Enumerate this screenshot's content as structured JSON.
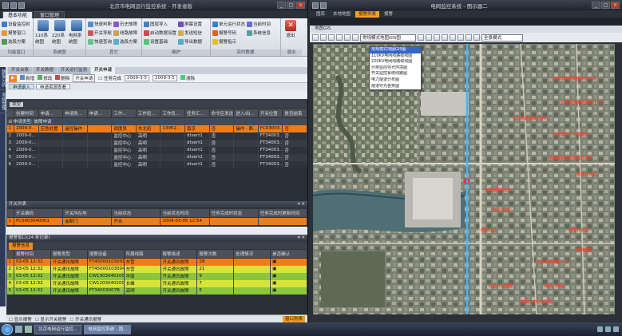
{
  "left_window": {
    "title": "北京市电网运行监控系统 - 开发者版",
    "ribbon_tabs": [
      "基本功能",
      "窗口管理"
    ],
    "ribbon_groups": [
      {
        "name": "功能窗口",
        "items": [
          "设备监控树",
          "报警窗口",
          "选段方案"
        ]
      },
      {
        "name": "系统图",
        "big": [
          "110系统图",
          "220系统图",
          "电网系统图"
        ]
      },
      {
        "name": "其它",
        "items": [
          "快速判断",
          "开关导航",
          "快速查询",
          "历史故障",
          "线路故障",
          "选段方案"
        ]
      },
      {
        "name": "维护",
        "items": [
          "图层导入",
          "启动数据设置",
          "设置基础",
          "屏幕设置",
          "发送短信",
          "导出数据"
        ]
      },
      {
        "name": "实时数据",
        "items": [
          "单元运行状态",
          "报警号码",
          "报警指示",
          "当前时间",
          "系统信息"
        ]
      },
      {
        "name": "退出",
        "big": [
          "退出"
        ]
      }
    ],
    "sidebar": [
      "数据分析",
      "系统管理"
    ],
    "doc_tabs": [
      "开关台账",
      "开关数据",
      "开关运行监测",
      "开关申请"
    ],
    "toolbar": {
      "checkbox": "任务完成",
      "date_from": "2009-3-5",
      "date_to": "2009-3-5",
      "clear_label": "清除",
      "add_label": "新增",
      "modify_label": "修改",
      "delete_label": "删除",
      "mode_label": "开关申请"
    },
    "sub_tabs": [
      "申请录入",
      "申请资源查看"
    ],
    "grid": {
      "group_label": "类型",
      "columns": [
        "创建时间",
        "申请...",
        "申请类...",
        "申请...",
        "工作...",
        "工作班...",
        "工作负...",
        "任务汇...",
        "命令区发送",
        "进入/出...",
        "开关位置",
        "是否结束"
      ],
      "subgroup": "申请类型: 故障申请",
      "rows": [
        {
          "style": "r-orange",
          "cells": [
            "2009-0...",
            "应急处置",
            "遥控操作",
            "",
            "调度员",
            "东北班",
            "13952...",
            "南京",
            "否",
            "操作 - 断...",
            "FC03003...",
            "否"
          ]
        },
        {
          "style": "r-dark",
          "cells": [
            "2009-0...",
            "",
            "",
            "",
            "监控中心",
            "高明",
            "",
            "dtsert1",
            "否",
            "",
            "FT34003...",
            "否"
          ]
        },
        {
          "style": "r-alt",
          "cells": [
            "2009-0...",
            "",
            "",
            "",
            "监控中心",
            "高明",
            "",
            "dtsert1",
            "否",
            "",
            "FT34003...",
            "否"
          ]
        },
        {
          "style": "r-dark",
          "cells": [
            "2009-0...",
            "",
            "",
            "",
            "监控中心",
            "高明",
            "",
            "dtsert1",
            "否",
            "",
            "FT34003...",
            "否"
          ]
        },
        {
          "style": "r-alt",
          "cells": [
            "2009-0...",
            "",
            "",
            "",
            "监控中心",
            "高明",
            "",
            "dtsert1",
            "否",
            "",
            "FT34003...",
            "否"
          ]
        },
        {
          "style": "r-dark",
          "cells": [
            "2009-0...",
            "",
            "",
            "",
            "监控中心",
            "高明",
            "",
            "dtsert1",
            "否",
            "",
            "FT34003...",
            "否"
          ]
        }
      ]
    },
    "switch_panel": {
      "title": "开关列表",
      "columns": [
        "开关编码",
        "开关所在地",
        "当前状态",
        "当前状态时间",
        "任务完成时状态",
        "任务完成时更新时间"
      ],
      "rows": [
        {
          "style": "r-orange",
          "cells": [
            "FC0003040001",
            "遥断门",
            "开合",
            "2009-03-05 12:54",
            "",
            ""
          ]
        }
      ]
    },
    "alarm_panel": {
      "title": "报警窗口(24 条记录)",
      "tab": "报警信息",
      "columns": [
        "报警时间",
        "报警类型",
        "报警设备",
        "所属线路",
        "报警描述",
        "报警次数",
        "处理情况",
        "是否确认"
      ],
      "rows": [
        {
          "style": "r-orange",
          "cells": [
            "03-05 12:32",
            "开关通讯故障",
            "FT45000103001",
            "东营",
            "开关通讯故障",
            "28",
            "",
            "▣"
          ]
        },
        {
          "style": "r-yellow",
          "cells": [
            "03-05 12:32",
            "开关通讯故障",
            "FT45000103004",
            "东营",
            "开关通讯故障",
            "21",
            "",
            "▣"
          ]
        },
        {
          "style": "r-green",
          "cells": [
            "03-05 12:32",
            "开关通讯故障",
            "CW13030401001",
            "华南",
            "开关通讯故障",
            "9",
            "",
            "▣"
          ]
        },
        {
          "style": "r-yellow",
          "cells": [
            "03-05 12:32",
            "开关通讯故障",
            "CW12030402004",
            "长峰",
            "开关通讯故障",
            "7",
            "",
            "▣"
          ]
        },
        {
          "style": "r-green",
          "cells": [
            "03-05 12:32",
            "开关通讯故障",
            "FT34003007B",
            "高明",
            "开关通讯故障",
            "5",
            "",
            "▣"
          ]
        }
      ]
    },
    "status_bar": [
      "显示报警",
      "显示开关报警",
      "开关通讯报警"
    ],
    "status_active": "窗口列表"
  },
  "right_window": {
    "title": "电网监控系统 - 图示器二",
    "ribbon_tabs": [
      "图库",
      "本地地图",
      "报警列表",
      "报警"
    ],
    "doc_tab": "地图GIS",
    "map_select": "常规模式地图GIS图",
    "map_options": [
      "常规模式地图GIS图",
      "110KV电网线路缆线图",
      "220KV电网线路缆线图",
      "分类监控导光环境图",
      "开关监控系统线路图",
      "电力隧道分布图",
      "隧道导光各类图"
    ],
    "mode_dropdown": "全景模式",
    "map_labels": [
      "北京市电网调度中心开关",
      "北京城市电网测试开关C",
      "东北电网调度分中心",
      "北京城市开关调度站",
      "电网控制运行测试开关B",
      "变电开关站",
      "电网调控中心B",
      "开关分中心",
      "电网分站",
      "城市开关站",
      "电网监控",
      "北京电网调度一号",
      "南大门电站",
      "东城分中心开关站",
      "北京开关管理"
    ]
  },
  "taskbar": {
    "tasks": [
      "北京电网运行监控...",
      "电网监控系统 - 图..."
    ],
    "active": 1
  },
  "colors": {
    "row_orange": "#ef7d17",
    "row_yellow": "#d6e43a",
    "row_green": "#8cc63e",
    "accent_blue": "#3366cc",
    "road_cyan": "#3fb6ff",
    "label_red": "#ff3d2a"
  }
}
